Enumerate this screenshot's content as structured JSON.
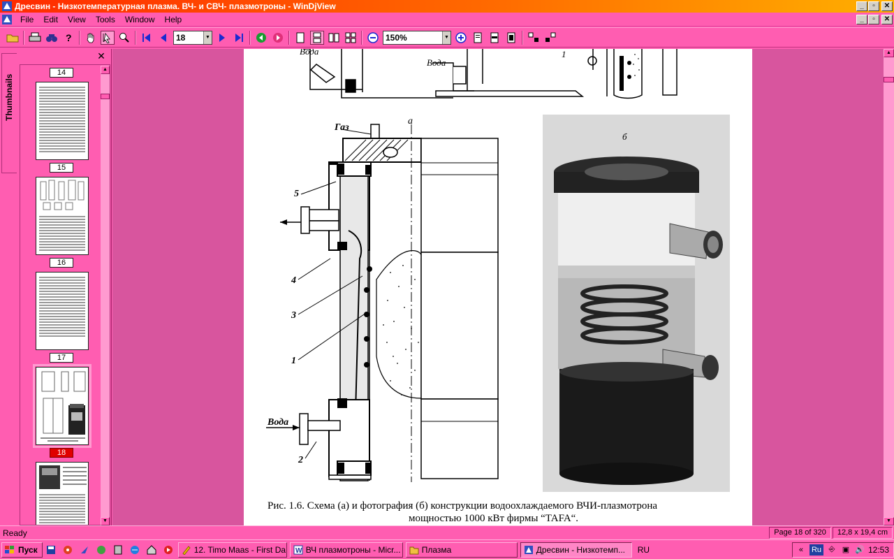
{
  "window": {
    "title": "Дресвин - Низкотемпературная плазма. ВЧ- и СВЧ- плазмотроны - WinDjView",
    "caption_buttons": [
      "_",
      "▫",
      "✕"
    ]
  },
  "menubar": {
    "items": [
      "File",
      "Edit",
      "View",
      "Tools",
      "Window",
      "Help"
    ]
  },
  "toolbar": {
    "page_value": "18",
    "zoom_value": "150%"
  },
  "sidebar": {
    "tab_label": "Thumbnails",
    "close_glyph": "✕",
    "pages": [
      {
        "label": "14",
        "selected": false
      },
      {
        "label": "15",
        "selected": false
      },
      {
        "label": "16",
        "selected": false
      },
      {
        "label": "17",
        "selected": false
      },
      {
        "label": "18",
        "selected": true
      }
    ]
  },
  "document": {
    "label_top_water": "Вода",
    "label_top_water2": "Вода",
    "label_gas": "Газ",
    "label_a": "а",
    "label_b": "б",
    "label_water_bottom": "Вода",
    "num_5": "5",
    "num_4": "4",
    "num_3": "3",
    "num_1": "1",
    "num_2": "2",
    "num_1_top": "1",
    "caption_line1": "Рис. 1.6. Схема (а) и фотография (б) конструкции водоохлаждаемого ВЧИ-плазмотрона",
    "caption_line2": "мощностью 1000 кВт фирмы “TAFA“."
  },
  "statusbar": {
    "status": "Ready",
    "page_info": "Page 18 of 320",
    "size_info": "12,8 x 19,4 cm"
  },
  "taskbar": {
    "start_label": "Пуск",
    "tasks": [
      {
        "label": "12. Timo Maas - First Da...",
        "active": false
      },
      {
        "label": "ВЧ плазмотроны - Micr...",
        "active": false
      },
      {
        "label": "Плазма",
        "active": false
      },
      {
        "label": "Дресвин - Низкотемп...",
        "active": true
      }
    ],
    "lang": "RU",
    "kbd": "Ru",
    "clock": "12:53"
  }
}
